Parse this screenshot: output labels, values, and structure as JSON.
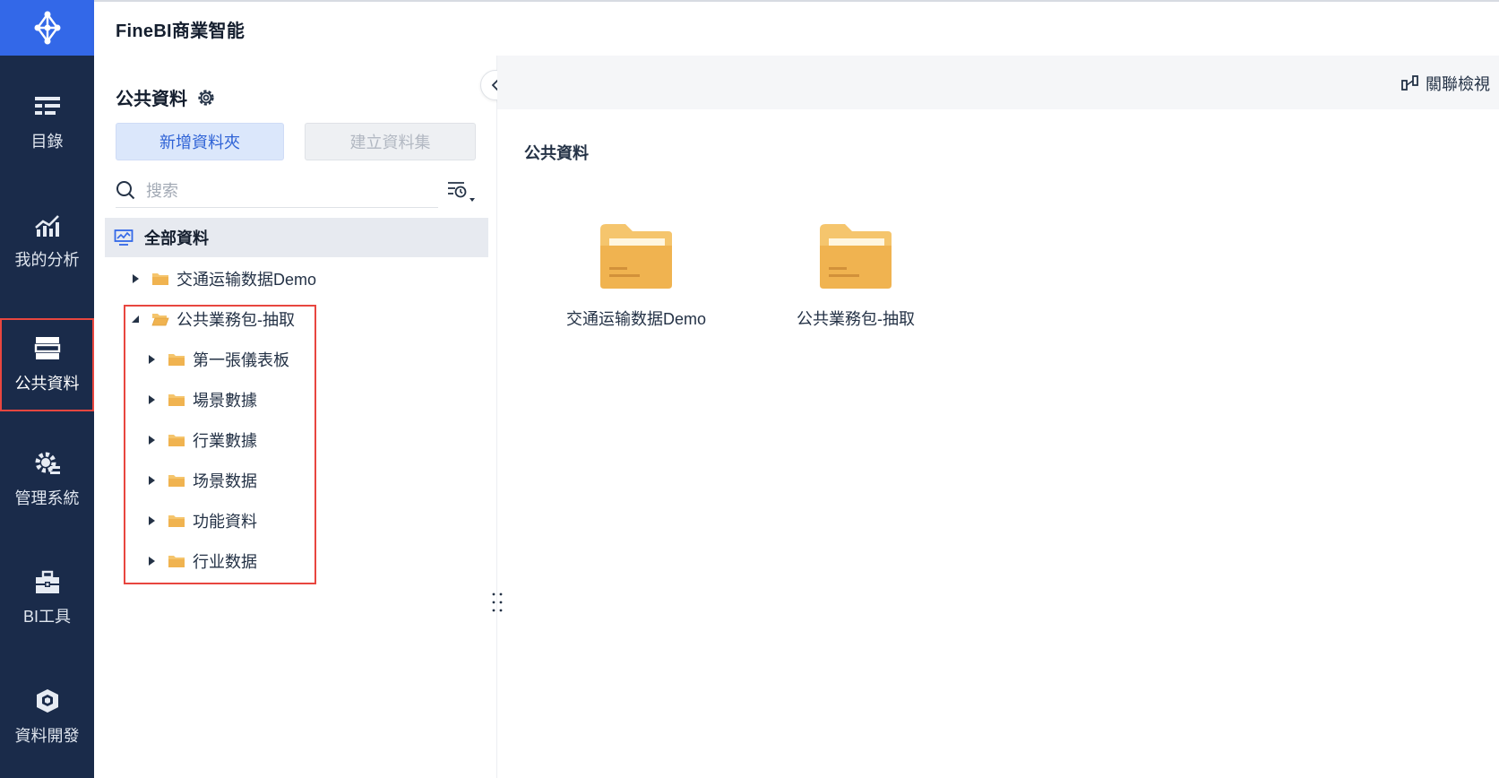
{
  "app": {
    "title": "FineBI商業智能"
  },
  "nav": {
    "logo_icon": "network-logo-icon",
    "items": [
      {
        "label": "目錄",
        "icon": "catalog-icon"
      },
      {
        "label": "我的分析",
        "icon": "analysis-chart-icon"
      },
      {
        "label": "公共資料",
        "icon": "public-data-icon",
        "active": true
      },
      {
        "label": "管理系統",
        "icon": "gear-manage-icon"
      },
      {
        "label": "BI工具",
        "icon": "toolbox-icon"
      },
      {
        "label": "資料開發",
        "icon": "cube-icon"
      }
    ]
  },
  "panel": {
    "title": "公共資料",
    "new_folder_label": "新增資料夾",
    "create_dataset_label": "建立資料集",
    "search_placeholder": "搜索",
    "root_label": "全部資料",
    "tree": [
      {
        "label": "交通运输数据Demo",
        "expanded": false,
        "level": 0
      },
      {
        "label": "公共業務包-抽取",
        "expanded": true,
        "level": 0
      },
      {
        "label": "第一張儀表板",
        "expanded": false,
        "level": 1
      },
      {
        "label": "場景數據",
        "expanded": false,
        "level": 1
      },
      {
        "label": "行業數據",
        "expanded": false,
        "level": 1
      },
      {
        "label": "场景数据",
        "expanded": false,
        "level": 1
      },
      {
        "label": "功能資料",
        "expanded": false,
        "level": 1
      },
      {
        "label": "行业数据",
        "expanded": false,
        "level": 1
      }
    ]
  },
  "content": {
    "link_view_label": "關聯檢視",
    "breadcrumb": "公共資料",
    "folders": [
      {
        "label": "交通运输数据Demo"
      },
      {
        "label": "公共業務包-抽取"
      }
    ]
  },
  "colors": {
    "nav_bg": "#1a2b4a",
    "logo_bg": "#3368e8",
    "accent": "#2f63d6",
    "folder": "#f0b350",
    "highlight": "#e8463f"
  }
}
